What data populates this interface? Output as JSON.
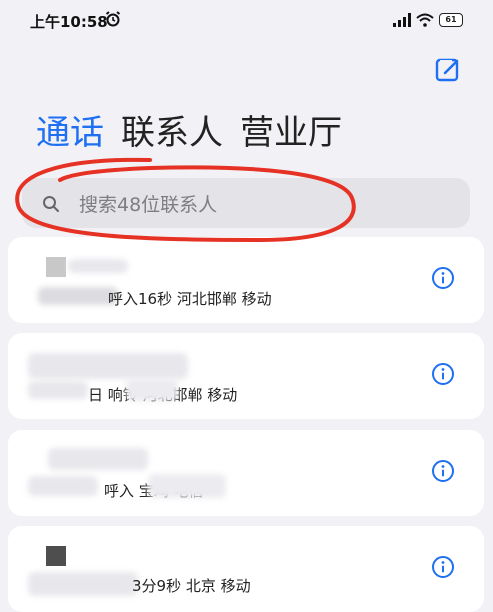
{
  "status": {
    "time": "上午10:58",
    "battery": "61"
  },
  "tabs": [
    "通话",
    "联系人",
    "营业厅"
  ],
  "search": {
    "placeholder": "搜索48位联系人"
  },
  "calls": [
    {
      "detail": "呼入16秒  河北邯郸  移动"
    },
    {
      "detail": "日  响铃     河北邯郸  移动"
    },
    {
      "detail": "呼入          宝鸡  电信"
    },
    {
      "detail": "3分9秒  北京  移动"
    }
  ],
  "colors": {
    "accent": "#1e6ff2",
    "annotation": "#e53224"
  },
  "icons": {
    "alarm": "alarm-icon",
    "edit": "edit-icon",
    "search": "search-icon",
    "info": "info-icon"
  }
}
